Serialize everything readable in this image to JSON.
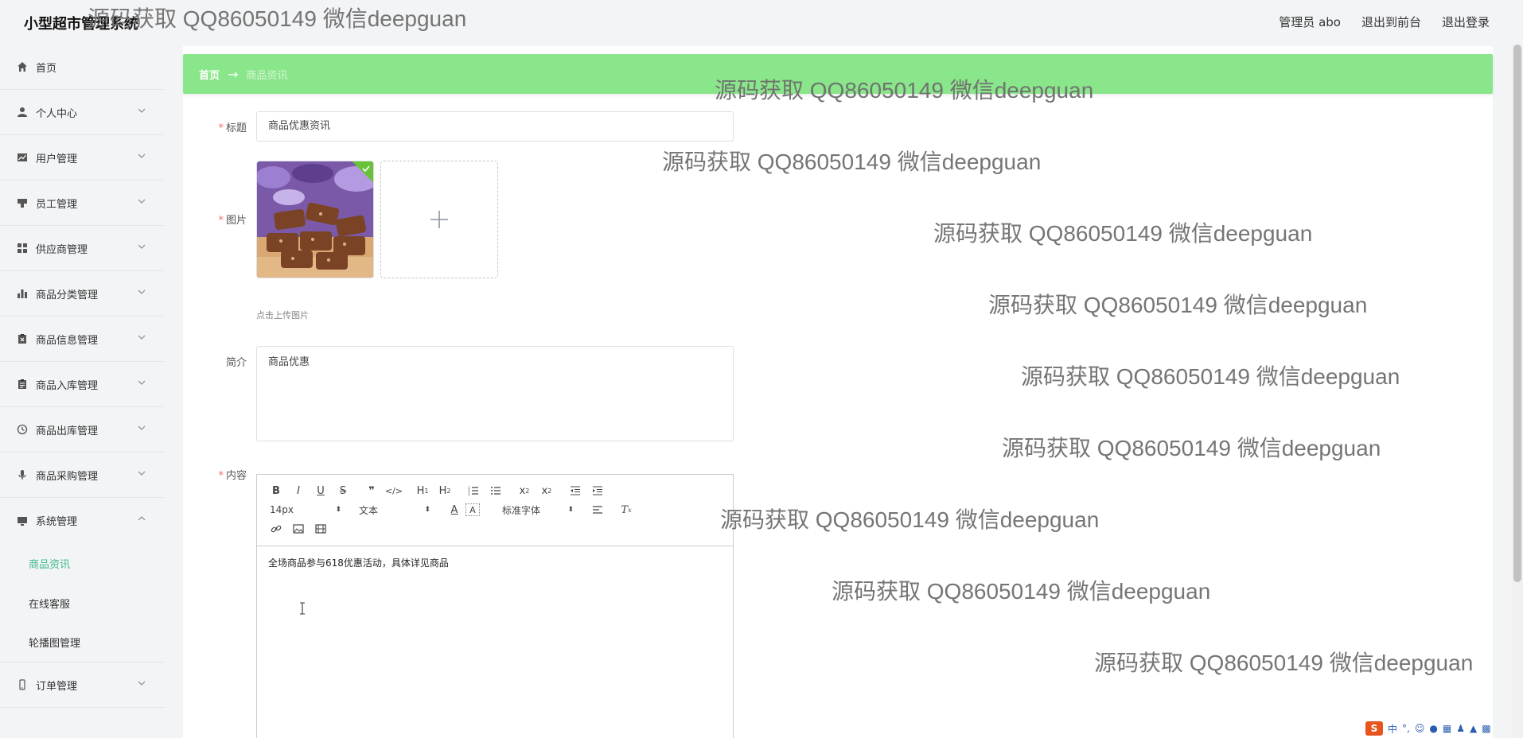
{
  "header": {
    "app_title": "小型超市管理系统",
    "admin_label": "管理员 abo",
    "back_to_front": "退出到前台",
    "logout": "退出登录"
  },
  "sidebar": {
    "items": [
      {
        "label": "首页",
        "icon": "home-icon"
      },
      {
        "label": "个人中心",
        "icon": "user-icon"
      },
      {
        "label": "用户管理",
        "icon": "chart-line-icon"
      },
      {
        "label": "员工管理",
        "icon": "stamp-icon"
      },
      {
        "label": "供应商管理",
        "icon": "grid-icon"
      },
      {
        "label": "商品分类管理",
        "icon": "bar-chart-icon"
      },
      {
        "label": "商品信息管理",
        "icon": "clipboard-x-icon"
      },
      {
        "label": "商品入库管理",
        "icon": "clipboard-icon"
      },
      {
        "label": "商品出库管理",
        "icon": "clock-icon"
      },
      {
        "label": "商品采购管理",
        "icon": "microphone-icon"
      },
      {
        "label": "系统管理",
        "icon": "monitor-icon"
      }
    ],
    "sub_items": [
      "商品资讯",
      "在线客服",
      "轮播图管理"
    ],
    "last_item": {
      "label": "订单管理",
      "icon": "phone-icon"
    },
    "active_color": "#3dbb8a"
  },
  "breadcrumb": {
    "home": "首页",
    "arrow": "→",
    "current": "商品资讯"
  },
  "form": {
    "title_label": "标题",
    "title_value": "商品优惠资讯",
    "image_label": "图片",
    "upload_tip": "点击上传图片",
    "summary_label": "简介",
    "summary_value": "商品优惠",
    "content_label": "内容",
    "content_value": "全场商品参与618优惠活动，具体详见商品"
  },
  "editor": {
    "font_size": "14px",
    "text_type": "文本",
    "font_family": "标准字体"
  },
  "watermark": "源码获取 QQ86050149 微信deepguan",
  "colors": {
    "breadcrumb_bg": "#8ae68a",
    "required": "#f56c6c"
  }
}
